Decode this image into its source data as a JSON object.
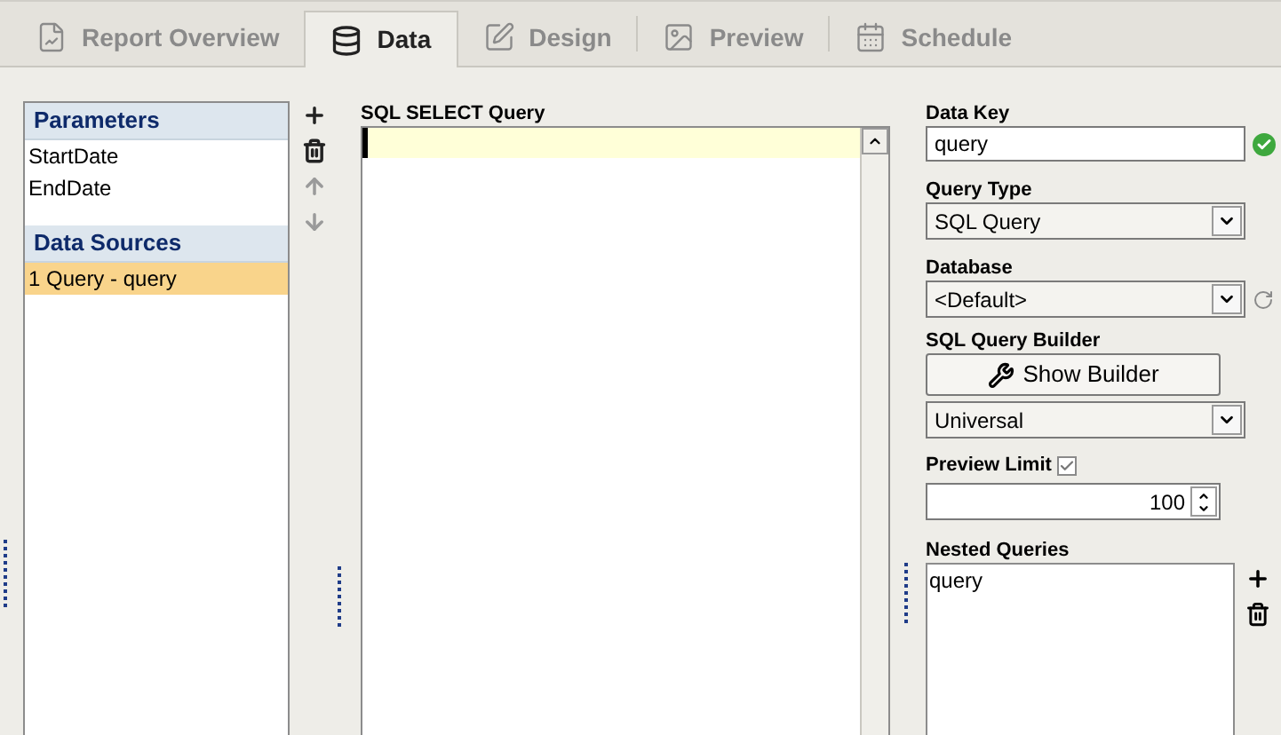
{
  "tabs": [
    {
      "kind": "report",
      "label": "Report Overview",
      "selected": false
    },
    {
      "kind": "data",
      "label": "Data",
      "selected": true
    },
    {
      "kind": "design",
      "label": "Design",
      "selected": false
    },
    {
      "kind": "preview",
      "label": "Preview",
      "selected": false
    },
    {
      "kind": "schedule",
      "label": "Schedule",
      "selected": false
    }
  ],
  "sections": [
    {
      "title": "Parameters",
      "items": [
        {
          "label": "StartDate",
          "selected": false
        },
        {
          "label": "EndDate",
          "selected": false
        }
      ]
    },
    {
      "title": "Data Sources",
      "items": [
        {
          "label": "1 Query - query",
          "selected": true
        }
      ]
    }
  ],
  "list_actions": [
    {
      "kind": "add",
      "disabled": false
    },
    {
      "kind": "delete",
      "disabled": false
    },
    {
      "kind": "up",
      "disabled": true
    },
    {
      "kind": "down",
      "disabled": true
    }
  ],
  "sql_editor": {
    "label": "SQL SELECT Query"
  },
  "data_key": {
    "label": "Data Key",
    "value": "query",
    "valid": true
  },
  "query_type": {
    "label": "Query Type",
    "value": "SQL Query"
  },
  "database": {
    "label": "Database",
    "value": "<Default>"
  },
  "query_builder": {
    "label": "SQL Query Builder",
    "button": "Show Builder",
    "dialect": "Universal"
  },
  "preview_limit": {
    "label": "Preview Limit",
    "checked": true,
    "value": "100"
  },
  "nested_queries": {
    "label": "Nested Queries",
    "items": [
      "query"
    ]
  }
}
